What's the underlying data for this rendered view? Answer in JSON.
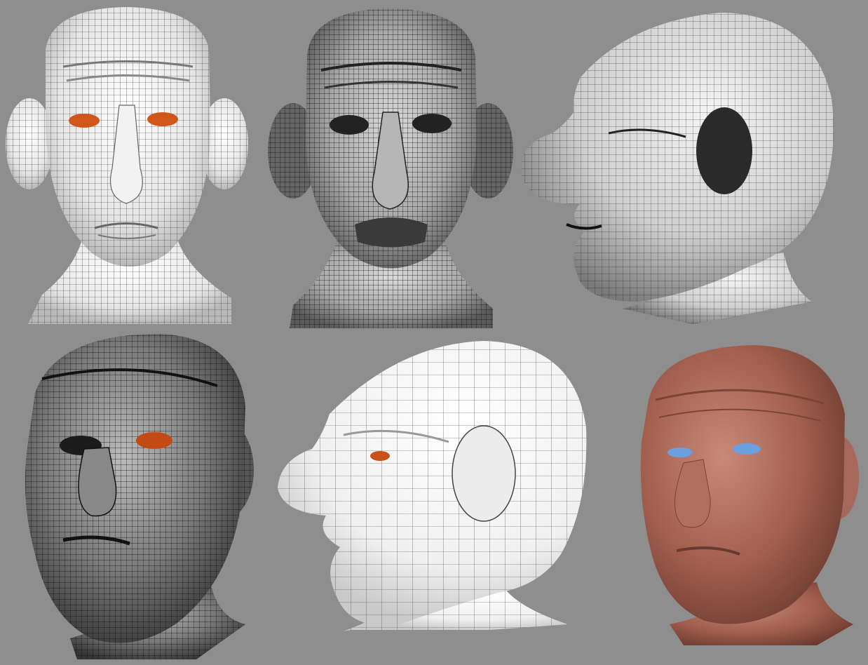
{
  "canvas": {
    "background": "#8e8e8e"
  },
  "renders": [
    {
      "id": "front-white-wire",
      "view": "front",
      "shading": "white",
      "wire": "#2a2a2a",
      "eye": "#d0561a"
    },
    {
      "id": "front-dark-wire",
      "view": "front",
      "shading": "gray",
      "wire": "#111111",
      "eye": "#3a2a1a"
    },
    {
      "id": "side-gray-wire",
      "view": "side-left",
      "shading": "light-gray",
      "wire": "#1a1a1a",
      "eye": "#222222"
    },
    {
      "id": "three-quarter-dark-wire",
      "view": "three-quarter",
      "shading": "dark",
      "wire": "#0e0e0e",
      "eye": "#c24a14"
    },
    {
      "id": "side-white-coarse",
      "view": "side-left",
      "shading": "white",
      "wire": "#3a3a3a",
      "eye": "#c9501a"
    },
    {
      "id": "three-quarter-skin",
      "view": "three-quarter",
      "shading": "skin",
      "wire": "none",
      "eye": "#6aa0e0"
    }
  ]
}
